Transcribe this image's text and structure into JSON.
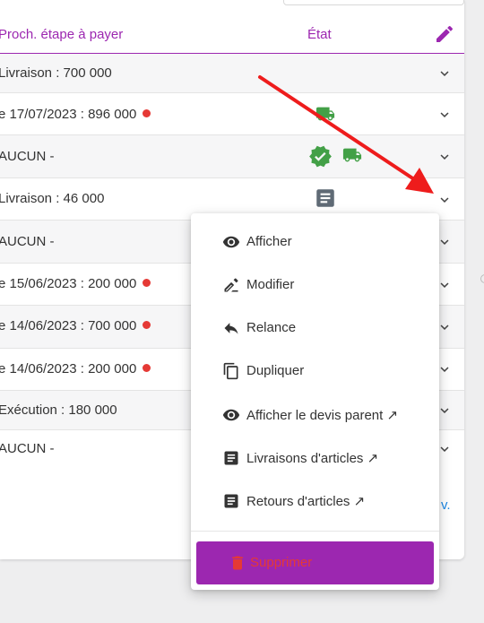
{
  "header": {
    "col_next_step": "Proch. étape à payer",
    "col_state": "État"
  },
  "rows": [
    {
      "text": "Livraison : 700 000",
      "overdue": false,
      "state_icons": []
    },
    {
      "text": "e 17/07/2023 : 896 000",
      "overdue": true,
      "state_icons": [
        "truck-icon"
      ]
    },
    {
      "text": " AUCUN -",
      "overdue": false,
      "state_icons": [
        "verified-badge-icon",
        "truck-icon"
      ]
    },
    {
      "text": "Livraison : 46 000",
      "overdue": false,
      "state_icons": [
        "document-icon"
      ]
    },
    {
      "text": " AUCUN -",
      "overdue": false,
      "state_icons": []
    },
    {
      "text": "e 15/06/2023 : 200 000",
      "overdue": true,
      "state_icons": []
    },
    {
      "text": "e 14/06/2023 : 700 000",
      "overdue": true,
      "state_icons": []
    },
    {
      "text": "e 14/06/2023 : 200 000",
      "overdue": true,
      "state_icons": []
    },
    {
      "text": "Exécution : 180 000",
      "overdue": false,
      "state_icons": []
    },
    {
      "text": " AUCUN -",
      "overdue": false,
      "state_icons": []
    }
  ],
  "context_menu": {
    "items": [
      {
        "label": "Afficher",
        "icon": "eye-icon"
      },
      {
        "label": "Modifier",
        "icon": "pencil-line-icon"
      },
      {
        "label": "Relance",
        "icon": "reply-icon"
      },
      {
        "label": "Dupliquer",
        "icon": "copy-icon"
      },
      {
        "label": "Afficher le devis parent ↗",
        "icon": "eye-icon"
      },
      {
        "label": "Livraisons d'articles ↗",
        "icon": "document-icon"
      },
      {
        "label": "Retours d'articles ↗",
        "icon": "document-icon"
      }
    ],
    "delete_label": "Supprimer"
  },
  "peek_link": "v.",
  "colors": {
    "accent_purple": "#9c27b0",
    "green": "#43a047",
    "red": "#e53935",
    "link_blue": "#1e88e5"
  }
}
